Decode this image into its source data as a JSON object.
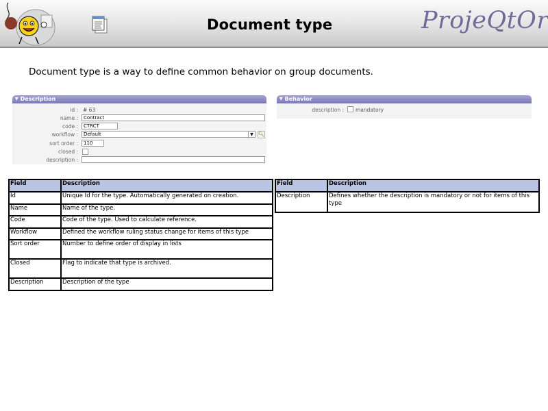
{
  "header": {
    "title": "Document type",
    "brand": "ProjeQtOr"
  },
  "intro": "Document type is a way to define common behavior on group documents.",
  "description_panel": {
    "title": "Description",
    "fields": [
      {
        "label": "id :",
        "value": "# 63"
      },
      {
        "label": "name :",
        "value": "Contract"
      },
      {
        "label": "code :",
        "value": "CTRCT"
      },
      {
        "label": "workflow :",
        "value": "Default"
      },
      {
        "label": "sort order :",
        "value": "110"
      },
      {
        "label": "closed :",
        "value": ""
      },
      {
        "label": "description :",
        "value": ""
      }
    ]
  },
  "behavior_panel": {
    "title": "Behavior",
    "field_label": "description :",
    "checkbox_label": "mandatory"
  },
  "fields_table": {
    "headers": [
      "Field",
      "Description"
    ],
    "rows": [
      [
        "Id",
        "Unique Id for the type. Automatically generated on creation."
      ],
      [
        "Name",
        "Name of the type."
      ],
      [
        "Code",
        "Code of the type. Used to calculate reference."
      ],
      [
        "Workflow",
        "Defined the workflow ruling status change for items of this type"
      ],
      [
        "Sort order",
        "Number to define order of display in lists"
      ],
      [
        "Closed",
        "Flag to indicate that type is archived."
      ],
      [
        "Description",
        "Description of the type"
      ]
    ]
  },
  "behavior_table": {
    "headers": [
      "Field",
      "Description"
    ],
    "rows": [
      [
        "Description",
        "Defines whether the description is mandatory or not for items of this type"
      ]
    ]
  },
  "colors": {
    "panel_header": "#8c8ac4",
    "table_header": "#b9c5e3",
    "brand": "#6f6a98"
  }
}
